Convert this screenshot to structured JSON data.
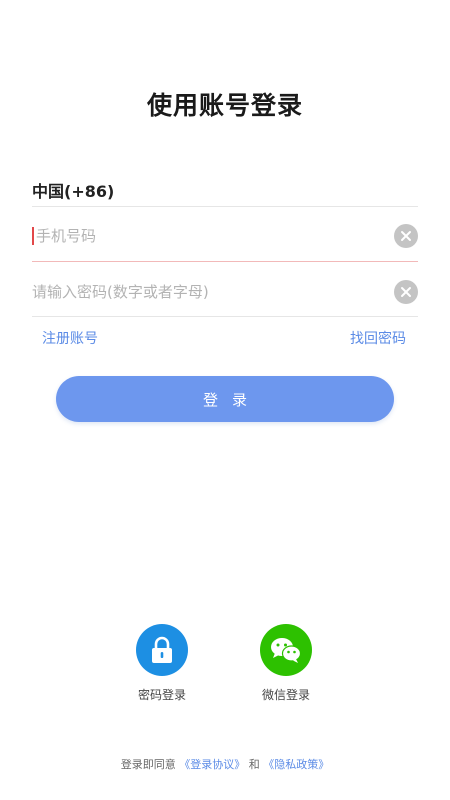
{
  "header": {
    "title": "使用账号登录"
  },
  "form": {
    "country_code": "中国(+86)",
    "phone_placeholder": "手机号码",
    "password_placeholder": "请输入密码(数字或者字母)"
  },
  "links": {
    "register": "注册账号",
    "forgot_password": "找回密码"
  },
  "login_button": {
    "label": "登录"
  },
  "alt_login": [
    {
      "label": "密码登录",
      "icon": "lock-icon",
      "color": "#1d8fe3"
    },
    {
      "label": "微信登录",
      "icon": "wechat-icon",
      "color": "#2dc100"
    }
  ],
  "agreement": {
    "prefix": "登录即同意",
    "terms": "《登录协议》",
    "connector": "和",
    "privacy": "《隐私政策》"
  },
  "colors": {
    "accent": "#6d97ee",
    "link": "#5b8be6",
    "caret": "#e2484a"
  }
}
